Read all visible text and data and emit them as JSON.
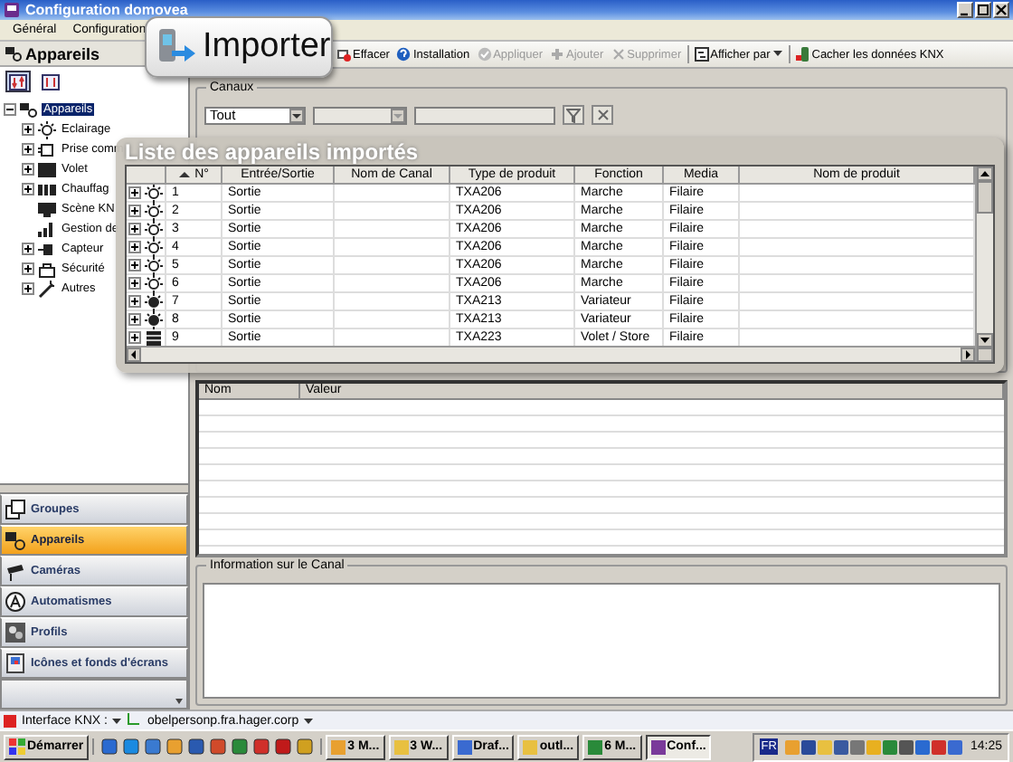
{
  "window": {
    "title": "Configuration domovea"
  },
  "menu": [
    "Général",
    "Configuration"
  ],
  "callout": {
    "label": "Importer"
  },
  "toolbar": [
    {
      "label": "Effacer",
      "kind": "button",
      "disabled": false
    },
    {
      "label": "Installation",
      "kind": "button",
      "disabled": false
    },
    {
      "label": "Appliquer",
      "kind": "button",
      "disabled": true
    },
    {
      "label": "Ajouter",
      "kind": "button",
      "disabled": true
    },
    {
      "label": "Supprimer",
      "kind": "button",
      "disabled": true
    },
    {
      "label": "Afficher par",
      "kind": "dropdown",
      "disabled": false
    },
    {
      "label": "Cacher les données KNX",
      "kind": "button",
      "disabled": false
    }
  ],
  "left_panel": {
    "title": "Appareils",
    "sort_buttons": [
      {
        "selected": true
      },
      {
        "selected": false
      }
    ],
    "tree": {
      "label": "Appareils",
      "selected": true,
      "expanded": true,
      "children": [
        {
          "label": "Eclairage",
          "kind": "folder",
          "expanded": false
        },
        {
          "label": "Prise comm",
          "kind": "folder",
          "expanded": false
        },
        {
          "label": "Volet",
          "kind": "folder",
          "expanded": false
        },
        {
          "label": "Chauffag",
          "kind": "folder",
          "expanded": false
        },
        {
          "label": "Scène KN",
          "kind": "leaf"
        },
        {
          "label": "Gestion de",
          "kind": "leaf"
        },
        {
          "label": "Capteur",
          "kind": "folder",
          "expanded": false
        },
        {
          "label": "Sécurité",
          "kind": "folder",
          "expanded": false
        },
        {
          "label": "Autres",
          "kind": "folder",
          "expanded": false
        }
      ]
    }
  },
  "nav": [
    {
      "label": "Groupes",
      "selected": false
    },
    {
      "label": "Appareils",
      "selected": true
    },
    {
      "label": "Caméras",
      "selected": false
    },
    {
      "label": "Automatismes",
      "selected": false
    },
    {
      "label": "Profils",
      "selected": false
    },
    {
      "label": "Icônes et fonds d'écrans",
      "selected": false
    }
  ],
  "channels": {
    "title": "Canaux",
    "filter": {
      "value": "Tout"
    }
  },
  "imported_list": {
    "title": "Liste des appareils importés",
    "columns": [
      "N°",
      "Entrée/Sortie",
      "Nom de Canal",
      "Type de produit",
      "Fonction",
      "Media",
      "Nom de produit"
    ],
    "rows": [
      {
        "kind": "bulb",
        "number": "1",
        "direction": "Sortie",
        "product_type": "TXA206",
        "function": "Marche",
        "media": "Filaire"
      },
      {
        "kind": "bulb",
        "number": "2",
        "direction": "Sortie",
        "product_type": "TXA206",
        "function": "Marche",
        "media": "Filaire"
      },
      {
        "kind": "bulb",
        "number": "3",
        "direction": "Sortie",
        "product_type": "TXA206",
        "function": "Marche",
        "media": "Filaire"
      },
      {
        "kind": "bulb",
        "number": "4",
        "direction": "Sortie",
        "product_type": "TXA206",
        "function": "Marche",
        "media": "Filaire"
      },
      {
        "kind": "bulb",
        "number": "5",
        "direction": "Sortie",
        "product_type": "TXA206",
        "function": "Marche",
        "media": "Filaire"
      },
      {
        "kind": "bulb",
        "number": "6",
        "direction": "Sortie",
        "product_type": "TXA206",
        "function": "Marche",
        "media": "Filaire"
      },
      {
        "kind": "dimmer",
        "number": "7",
        "direction": "Sortie",
        "product_type": "TXA213",
        "function": "Variateur",
        "media": "Filaire"
      },
      {
        "kind": "dimmer",
        "number": "8",
        "direction": "Sortie",
        "product_type": "TXA213",
        "function": "Variateur",
        "media": "Filaire"
      },
      {
        "kind": "shutter",
        "number": "9",
        "direction": "Sortie",
        "product_type": "TXA223",
        "function": "Volet / Store",
        "media": "Filaire"
      }
    ]
  },
  "properties": {
    "columns": [
      "Nom",
      "Valeur"
    ]
  },
  "channel_info": {
    "title": "Information sur le Canal"
  },
  "status_bar": {
    "interface_label": "Interface KNX :",
    "host": "obelpersonp.fra.hager.corp"
  },
  "taskbar": {
    "start": "Démarrer",
    "tasks": [
      {
        "label": "3 M...",
        "selected": false
      },
      {
        "label": "3 W...",
        "selected": false
      },
      {
        "label": "Draf...",
        "selected": false
      },
      {
        "label": "outl...",
        "selected": false
      },
      {
        "label": "6 M...",
        "selected": false
      },
      {
        "label": "Conf...",
        "selected": true
      }
    ],
    "language": "FR",
    "clock": "14:25"
  }
}
